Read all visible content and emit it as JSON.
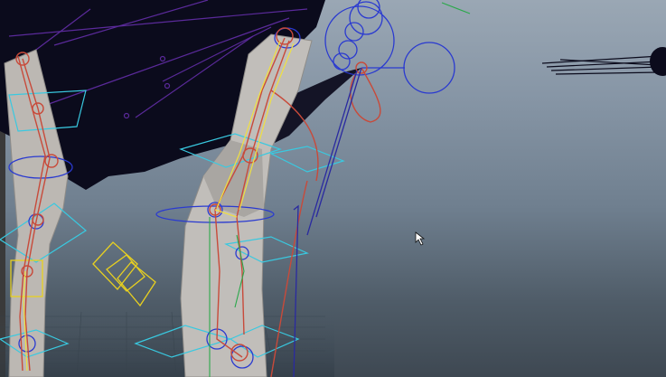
{
  "viewport": {
    "name": "3d-viewport",
    "background_colors": [
      "#9aa7b4",
      "#6f7f8f",
      "#3e4852"
    ]
  },
  "scene": {
    "mesh_color": "#b9b6b2",
    "shadow_color": "#0a0a18",
    "joint_color": "#c84a3a",
    "bone_color": "#f0e040",
    "control_blue": "#2a3ad0",
    "control_cyan": "#39c9e0",
    "control_purple": "#5a2a9a",
    "control_yellow": "#e8d020",
    "green_curve": "#2aa84a"
  },
  "cursor": {
    "icon": "arrow-cursor-icon"
  }
}
